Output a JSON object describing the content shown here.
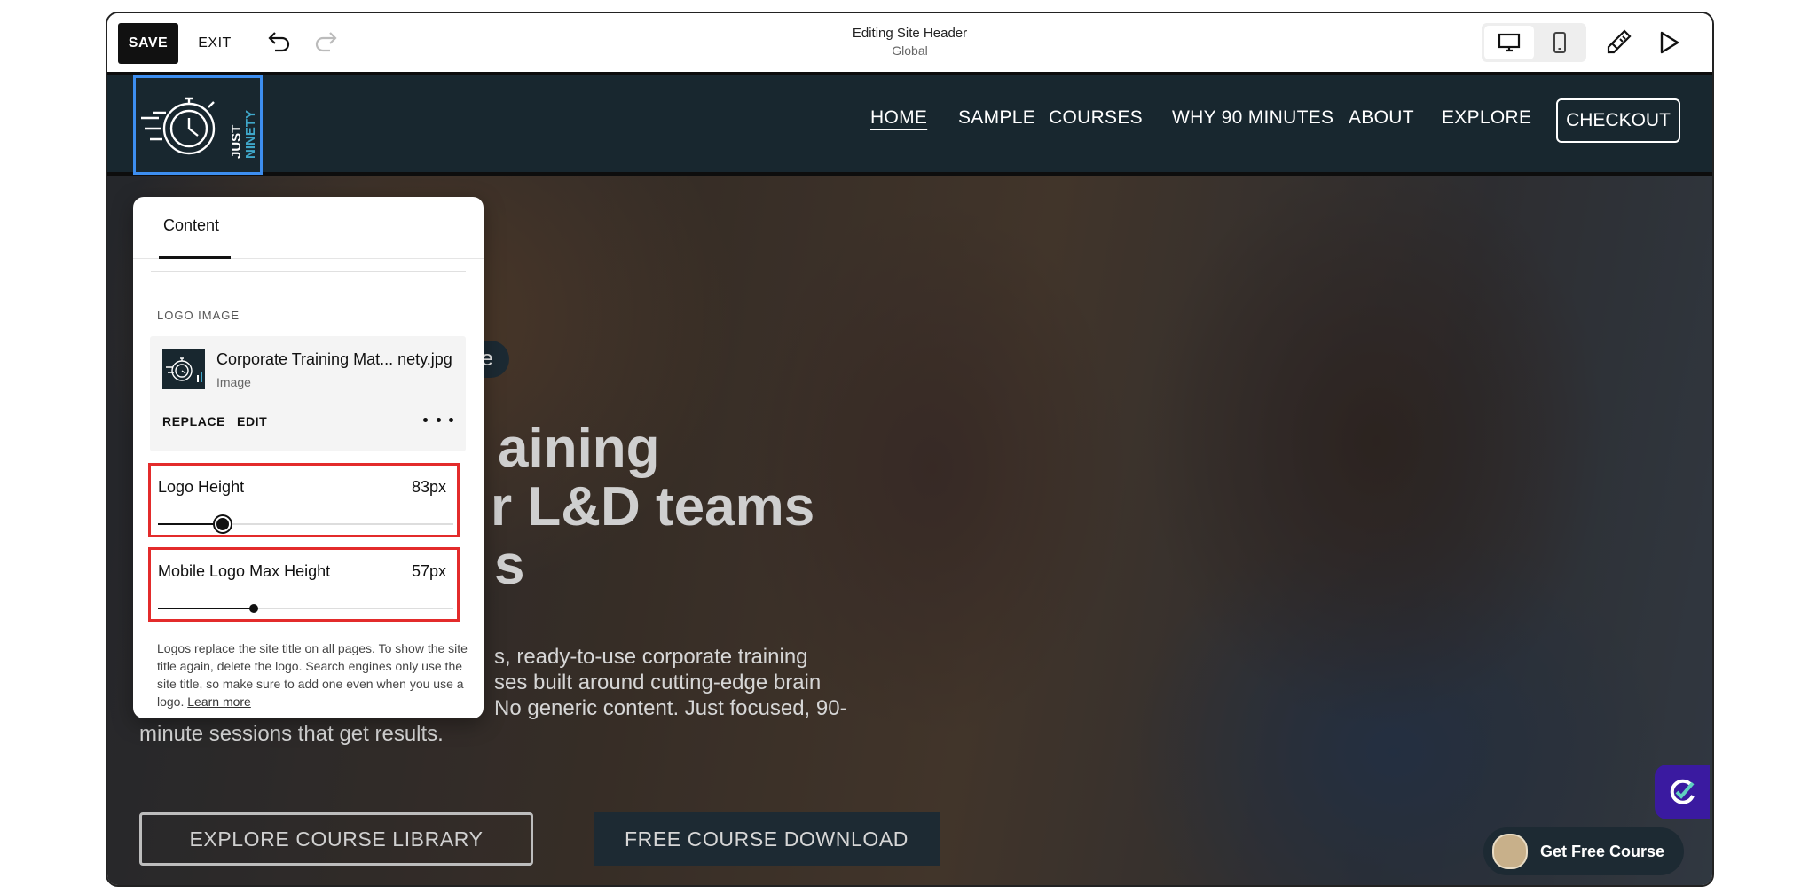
{
  "toolbar": {
    "save_label": "SAVE",
    "exit_label": "EXIT",
    "editing_title": "Editing Site Header",
    "editing_scope": "Global"
  },
  "site_header": {
    "logo_text": [
      "JUST",
      "NINETY"
    ],
    "nav": [
      "HOME",
      "SAMPLE",
      "COURSES",
      "WHY 90 MINUTES",
      "ABOUT",
      "EXPLORE"
    ],
    "checkout_label": "CHECKOUT"
  },
  "hero": {
    "badge_text": "ur change",
    "headline_line1": "aining",
    "headline_line2": "r L&D teams",
    "headline_line3": "s",
    "para_line1": "s, ready-to-use corporate training",
    "para_line2": "ses built around cutting-edge brain",
    "para_line3": "No generic content. Just focused, 90-",
    "para_line4": "minute sessions that get results.",
    "cta_primary": "EXPLORE COURSE LIBRARY",
    "cta_secondary": "FREE COURSE DOWNLOAD",
    "get_free_label": "Get Free Course"
  },
  "panel": {
    "tab": "Content",
    "section_label": "LOGO IMAGE",
    "file_name": "Corporate Training Mat... nety.jpg",
    "file_type": "Image",
    "replace_label": "REPLACE",
    "edit_label": "EDIT",
    "logo_height_label": "Logo Height",
    "logo_height_value": "83px",
    "logo_height_fraction": 0.22,
    "mobile_label": "Mobile Logo Max Height",
    "mobile_value": "57px",
    "mobile_fraction": 0.325,
    "note": "Logos replace the site title on all pages. To show the site title again, delete the logo. Search engines only use the site title, so make sure to add one even when you use a logo.",
    "learn_more": "Learn more"
  },
  "icons": {
    "undo": "undo-icon",
    "redo": "redo-icon",
    "desktop": "desktop-icon",
    "mobile": "mobile-icon",
    "brush": "paintbrush-icon",
    "play": "play-icon"
  },
  "colors": {
    "header_bg": "#18272f",
    "selection": "#3d8ef0",
    "highlight": "#e32b2b",
    "accent_logo": "#3fa7c9"
  }
}
